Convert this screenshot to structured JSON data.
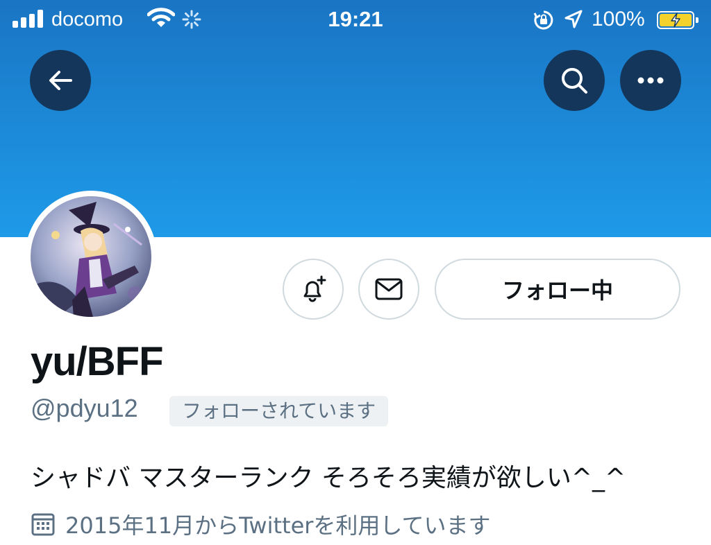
{
  "status_bar": {
    "carrier": "docomo",
    "time": "19:21",
    "battery_percent": "100%"
  },
  "nav": {
    "back_icon": "arrow-left-icon",
    "search_icon": "search-icon",
    "more_icon": "ellipsis-icon"
  },
  "profile": {
    "display_name": "yu/BFF",
    "handle": "@pdyu12",
    "follows_you_badge": "フォローされています",
    "bio": "シャドバ マスターランク そろそろ実績が欲しい^_^",
    "joined": "2015年11月からTwitterを利用しています"
  },
  "actions": {
    "follow_label": "フォロー中"
  },
  "colors": {
    "banner_top": "#1a75c4",
    "banner_bottom": "#1e9ae8",
    "nav_button": "#14365a",
    "battery_fill": "#f4d22b",
    "secondary_text": "#5b7083"
  }
}
